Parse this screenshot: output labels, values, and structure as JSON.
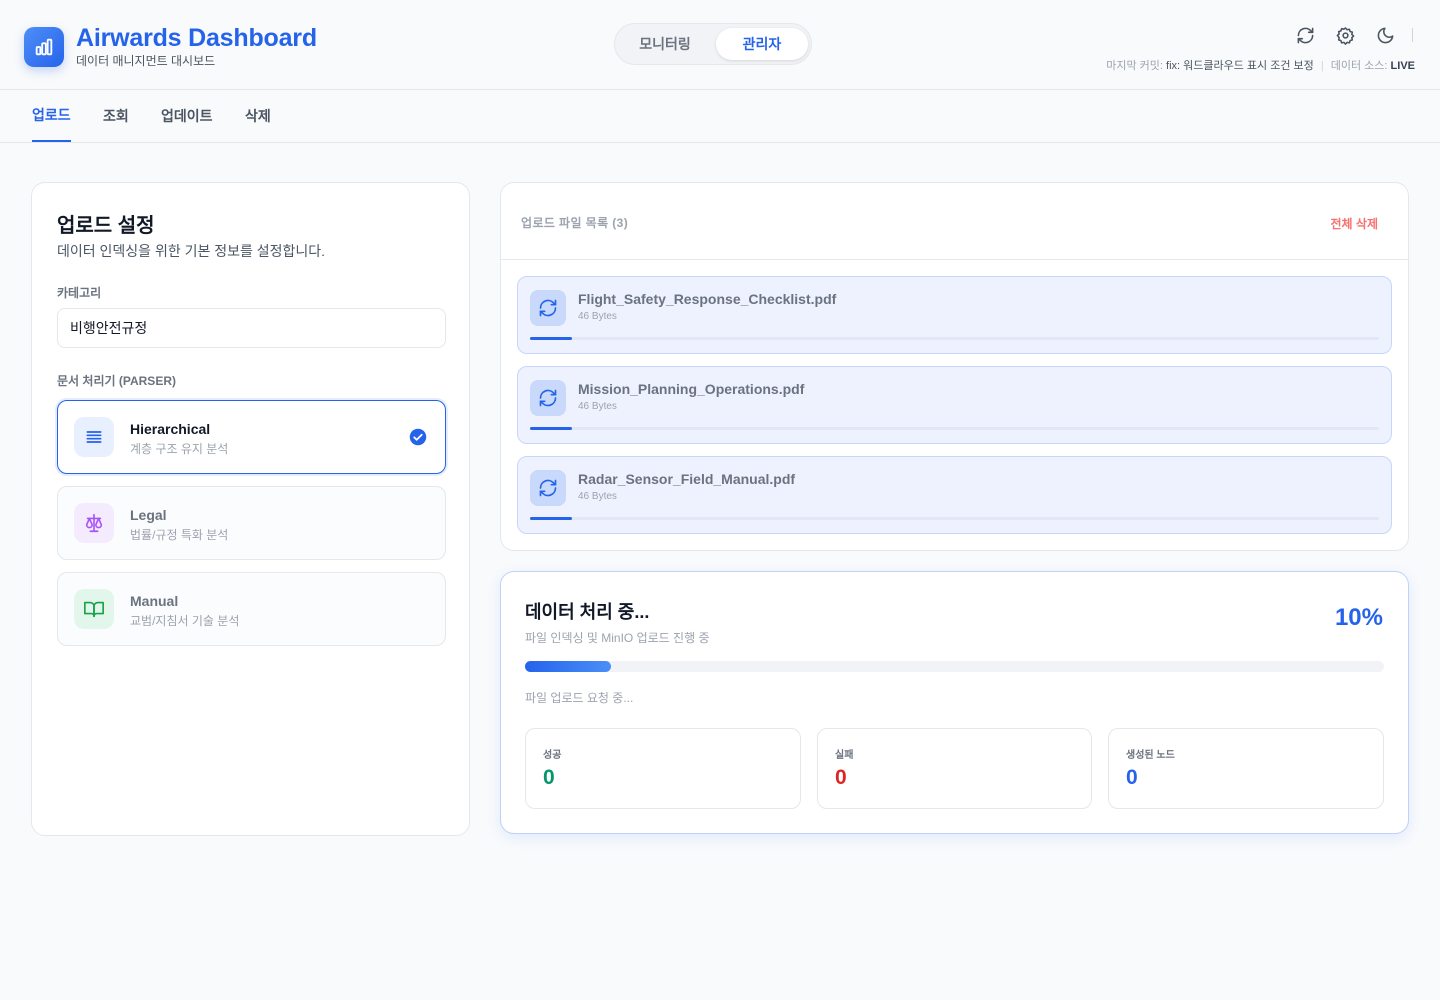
{
  "header": {
    "title": "Airwards Dashboard",
    "subtitle": "데이터 매니지먼트 대시보드",
    "modes": [
      "모니터링",
      "관리자"
    ],
    "active_mode": "관리자",
    "commit_label": "마지막 커밋:",
    "commit_value": "fix: 워드클라우드 표시 조건 보정",
    "source_label": "데이터 소스:",
    "source_value": "LIVE",
    "icons": [
      "refresh-icon",
      "gear-icon",
      "moon-icon"
    ]
  },
  "tabs": [
    {
      "label": "업로드",
      "active": true
    },
    {
      "label": "조회",
      "active": false
    },
    {
      "label": "업데이트",
      "active": false
    },
    {
      "label": "삭제",
      "active": false
    }
  ],
  "upload_settings": {
    "title": "업로드 설정",
    "subtitle": "데이터 인덱싱을 위한 기본 정보를 설정합니다.",
    "category_label": "카테고리",
    "category_value": "비행안전규정",
    "parser_label": "문서 처리기 (PARSER)",
    "parsers": [
      {
        "name": "Hierarchical",
        "desc": "계층 구조 유지 분석",
        "selected": true,
        "icon": "list-icon",
        "color": "#2563eb"
      },
      {
        "name": "Legal",
        "desc": "법률/규정 특화 분석",
        "selected": false,
        "icon": "scale-icon",
        "color": "#a855f7"
      },
      {
        "name": "Manual",
        "desc": "교범/지침서 기술 분석",
        "selected": false,
        "icon": "book-icon",
        "color": "#16a34a"
      }
    ]
  },
  "file_list": {
    "title": "업로드 파일 목록 (3)",
    "delete_all": "전체 삭제",
    "files": [
      {
        "name": "Flight_Safety_Response_Checklist.pdf",
        "size": "46 Bytes",
        "progress": 0.05
      },
      {
        "name": "Mission_Planning_Operations.pdf",
        "size": "46 Bytes",
        "progress": 0.05
      },
      {
        "name": "Radar_Sensor_Field_Manual.pdf",
        "size": "46 Bytes",
        "progress": 0.05
      }
    ]
  },
  "processing": {
    "title": "데이터 처리 중...",
    "subtitle": "파일 인덱싱 및 MinIO 업로드 진행 중",
    "percent_text": "10%",
    "percent": 10,
    "status": "파일 업로드 요청 중...",
    "stats": [
      {
        "label": "성공",
        "value": "0",
        "color": "#059669"
      },
      {
        "label": "실패",
        "value": "0",
        "color": "#dc2626"
      },
      {
        "label": "생성된 노드",
        "value": "0",
        "color": "#2563eb"
      }
    ]
  }
}
